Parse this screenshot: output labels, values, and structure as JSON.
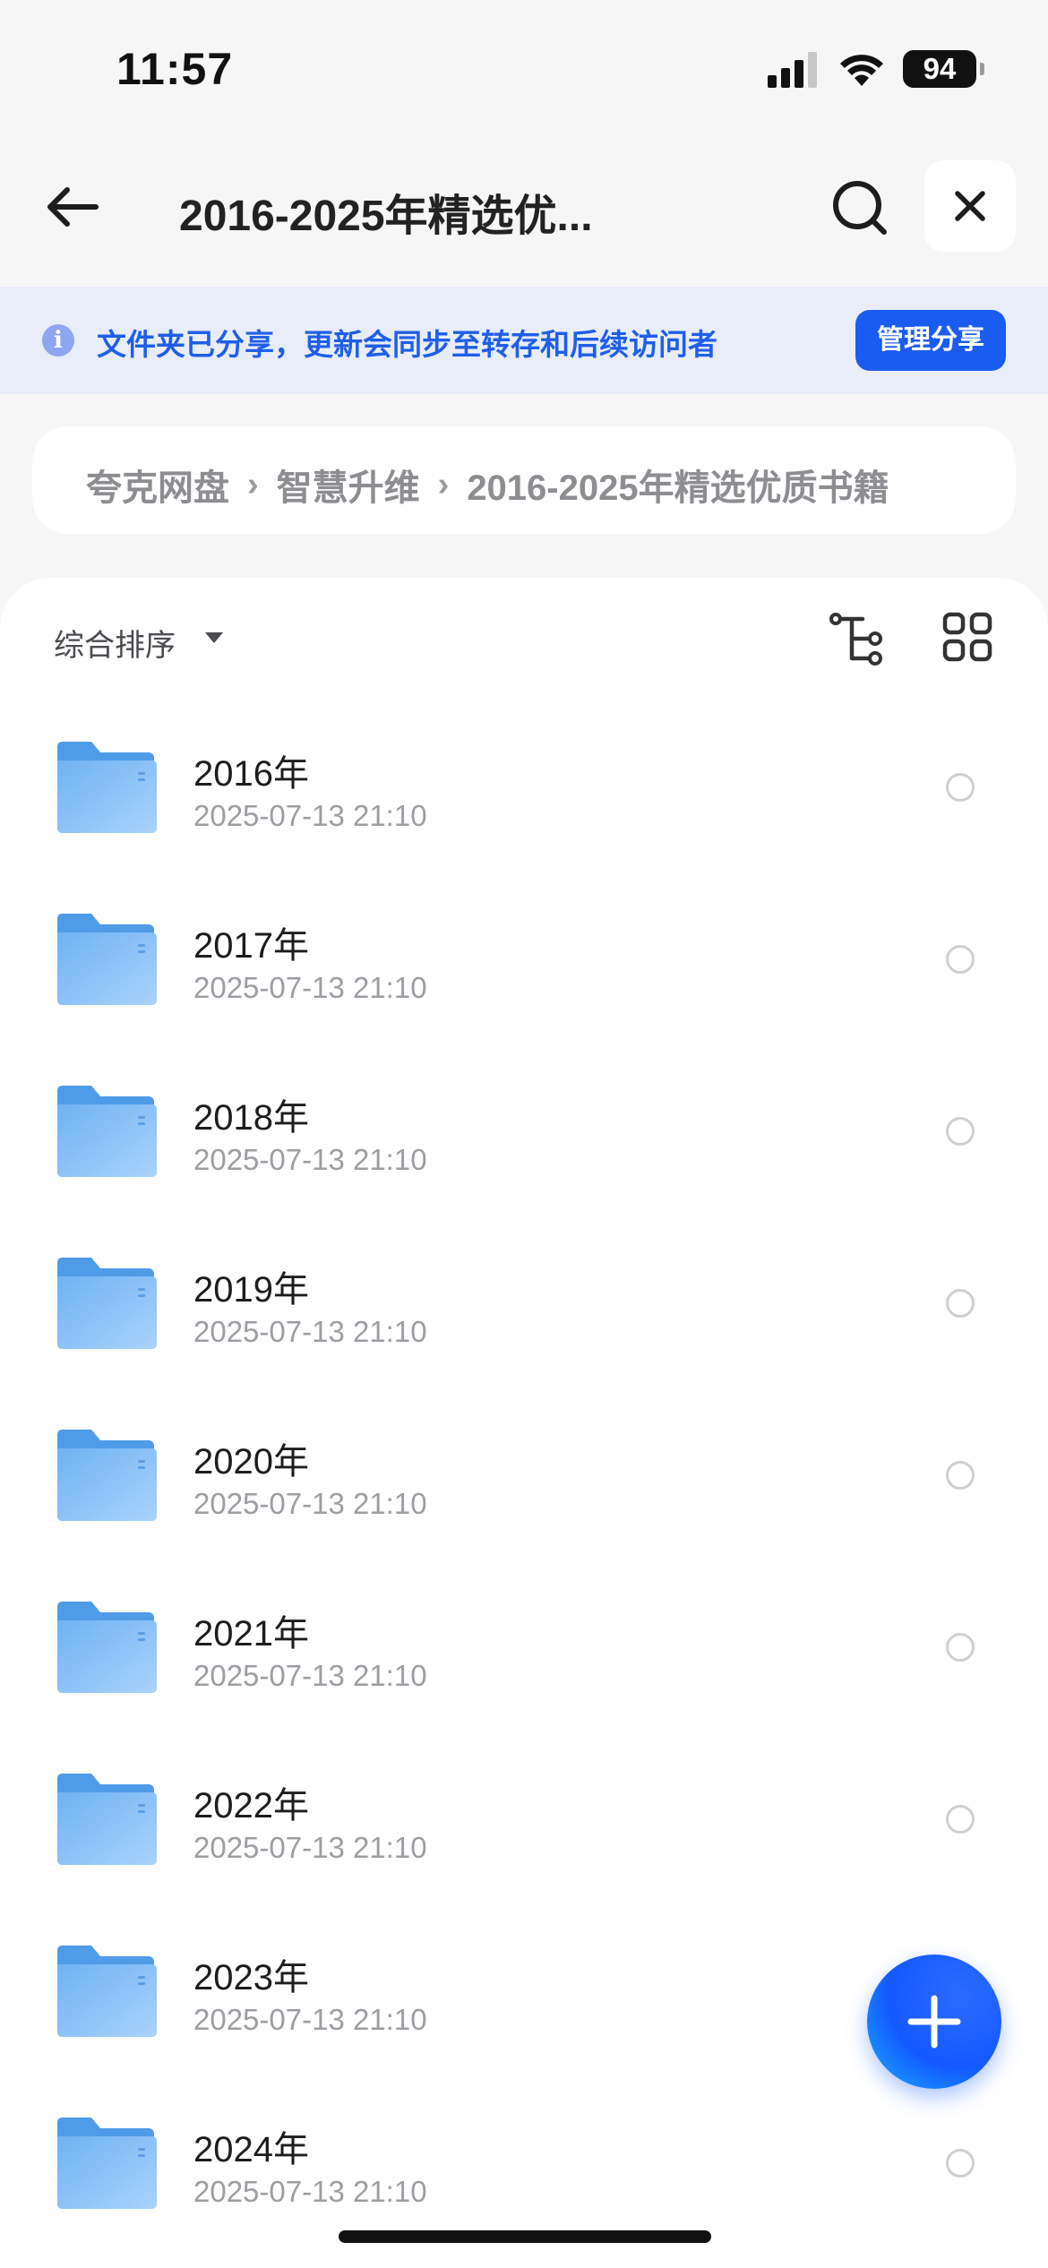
{
  "status_bar": {
    "time": "11:57",
    "battery": "94"
  },
  "header": {
    "title": "2016-2025年精选优...",
    "back_icon": "arrow-left-icon",
    "search_icon": "search-icon",
    "close_icon": "close-icon"
  },
  "notice": {
    "icon": "info-icon",
    "text": "文件夹已分享，更新会同步至转存和后续访问者",
    "button": "管理分享",
    "colors": {
      "accent": "#1a5cf0",
      "background": "#e9edf9"
    }
  },
  "breadcrumb": {
    "items": [
      "夸克网盘",
      "智慧升维",
      "2016-2025年精选优质书籍"
    ],
    "separator": "›"
  },
  "toolbar": {
    "sort_label": "综合排序",
    "tree_icon": "tree-view-icon",
    "grid_icon": "grid-view-icon"
  },
  "files": [
    {
      "name": "2016年",
      "date": "2025-07-13 21:10"
    },
    {
      "name": "2017年",
      "date": "2025-07-13 21:10"
    },
    {
      "name": "2018年",
      "date": "2025-07-13 21:10"
    },
    {
      "name": "2019年",
      "date": "2025-07-13 21:10"
    },
    {
      "name": "2020年",
      "date": "2025-07-13 21:10"
    },
    {
      "name": "2021年",
      "date": "2025-07-13 21:10"
    },
    {
      "name": "2022年",
      "date": "2025-07-13 21:10"
    },
    {
      "name": "2023年",
      "date": "2025-07-13 21:10"
    },
    {
      "name": "2024年",
      "date": "2025-07-13 21:10"
    }
  ],
  "fab": {
    "icon": "plus-icon"
  }
}
